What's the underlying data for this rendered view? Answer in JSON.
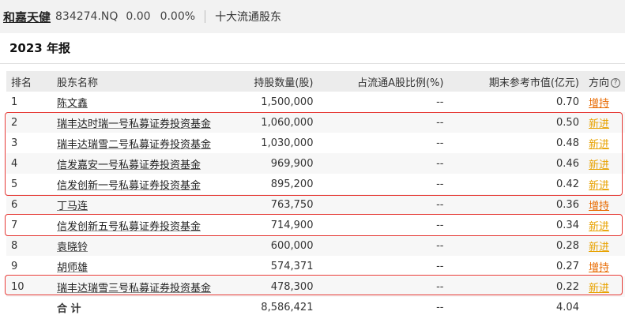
{
  "header": {
    "stock_name": "和嘉天健",
    "stock_code": "834274.NQ",
    "price": "0.00",
    "change_pct": "0.00%",
    "section": "十大流通股东"
  },
  "report_title": "2023 年报",
  "table": {
    "columns": [
      "排名",
      "股东名称",
      "持股数量(股)",
      "占流通A股比例(%)",
      "期末参考市值(亿元)",
      "方向"
    ],
    "rows": [
      {
        "rank": "1",
        "name": "陈文鑫",
        "shares": "1,500,000",
        "ratio": "--",
        "value": "0.70",
        "direction": "增持"
      },
      {
        "rank": "2",
        "name": "瑞丰达时瑞一号私募证券投资基金",
        "shares": "1,060,000",
        "ratio": "--",
        "value": "0.50",
        "direction": "新进"
      },
      {
        "rank": "3",
        "name": "瑞丰达瑞雪二号私募证券投资基金",
        "shares": "1,030,000",
        "ratio": "--",
        "value": "0.48",
        "direction": "新进"
      },
      {
        "rank": "4",
        "name": "信发嘉安一号私募证券投资基金",
        "shares": "969,900",
        "ratio": "--",
        "value": "0.46",
        "direction": "新进"
      },
      {
        "rank": "5",
        "name": "信发创新一号私募证券投资基金",
        "shares": "895,200",
        "ratio": "--",
        "value": "0.42",
        "direction": "新进"
      },
      {
        "rank": "6",
        "name": "丁马连",
        "shares": "763,750",
        "ratio": "--",
        "value": "0.36",
        "direction": "增持"
      },
      {
        "rank": "7",
        "name": "信发创新五号私募证券投资基金",
        "shares": "714,900",
        "ratio": "--",
        "value": "0.34",
        "direction": "新进"
      },
      {
        "rank": "8",
        "name": "袁晓铃",
        "shares": "600,000",
        "ratio": "--",
        "value": "0.28",
        "direction": "新进"
      },
      {
        "rank": "9",
        "name": "胡师雄",
        "shares": "574,371",
        "ratio": "--",
        "value": "0.27",
        "direction": "增持"
      },
      {
        "rank": "10",
        "name": "瑞丰达瑞雪三号私募证券投资基金",
        "shares": "478,300",
        "ratio": "--",
        "value": "0.22",
        "direction": "新进"
      }
    ],
    "total": {
      "label": "合 计",
      "shares": "8,586,421",
      "ratio": "--",
      "value": "4.04"
    }
  },
  "colors": {
    "increase": "#e86a00",
    "new": "#e8a200",
    "highlight_box": "#e53935"
  },
  "icons": {
    "direction_help": "question-circle-icon"
  }
}
